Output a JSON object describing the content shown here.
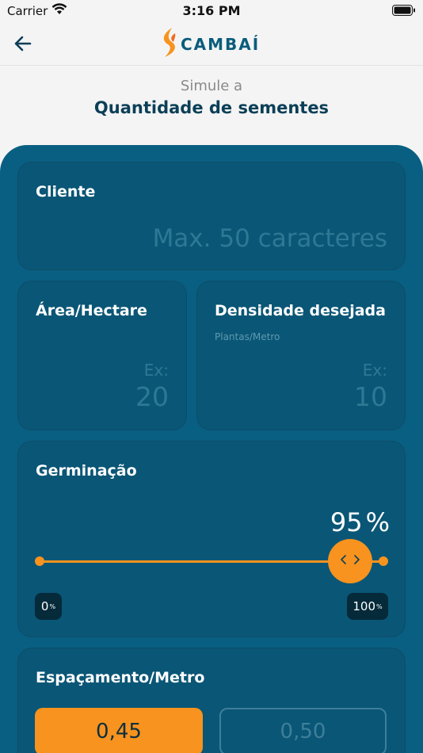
{
  "status_bar": {
    "carrier": "Carrier",
    "time": "3:16 PM"
  },
  "navbar": {
    "brand": "CAMBAÍ"
  },
  "header": {
    "subtitle": "Simule a",
    "title": "Quantidade de sementes"
  },
  "form": {
    "cliente": {
      "label": "Cliente",
      "placeholder": "Max. 50 caracteres"
    },
    "area": {
      "label": "Área/Hectare",
      "placeholder_prefix": "Ex:",
      "placeholder_value": "20"
    },
    "densidade": {
      "label": "Densidade desejada",
      "sublabel": "Plantas/Metro",
      "placeholder_prefix": "Ex:",
      "placeholder_value": "10"
    },
    "germinacao": {
      "label": "Germinação",
      "value": "95",
      "unit": "%",
      "min_label": "0",
      "max_label": "100",
      "unit_small": "%",
      "level": 0.95
    },
    "espacamento": {
      "label": "Espaçamento/Metro",
      "options": [
        "0,45",
        "0,50"
      ],
      "selected": "0,45"
    }
  },
  "colors": {
    "brand_blue": "#095f82",
    "accent_orange": "#f7931e",
    "title_navy": "#0b3f57"
  }
}
